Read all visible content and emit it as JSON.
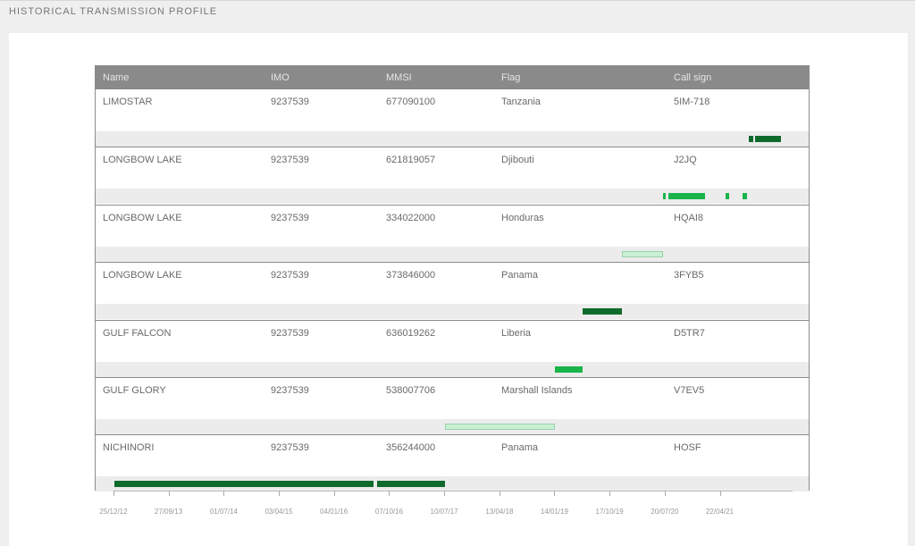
{
  "page_title": "HISTORICAL TRANSMISSION PROFILE",
  "columns": [
    "Name",
    "IMO",
    "MMSI",
    "Flag",
    "Call sign"
  ],
  "rows": [
    {
      "name": "LIMOSTAR",
      "imo": "9237539",
      "mmsi": "677090100",
      "flag": "Tanzania",
      "call_sign": "5IM-718",
      "periods": [
        {
          "start": "2021-09-10",
          "end": "2021-10-01",
          "color": "#0e6b2c"
        },
        {
          "start": "2021-10-10",
          "end": "2022-02-20",
          "color": "#0e6b2c"
        }
      ]
    },
    {
      "name": "LONGBOW LAKE",
      "imo": "9237539",
      "mmsi": "621819057",
      "flag": "Djibouti",
      "call_sign": "J2JQ",
      "periods": [
        {
          "start": "2020-07-05",
          "end": "2020-07-20",
          "color": "#19b44a"
        },
        {
          "start": "2020-08-05",
          "end": "2021-02-01",
          "color": "#19b44a"
        },
        {
          "start": "2021-05-15",
          "end": "2021-06-05",
          "color": "#19b44a"
        },
        {
          "start": "2021-08-10",
          "end": "2021-08-30",
          "color": "#19b44a"
        }
      ]
    },
    {
      "name": "LONGBOW LAKE",
      "imo": "9237539",
      "mmsi": "334022000",
      "flag": "Honduras",
      "call_sign": "HQAI8",
      "periods": [
        {
          "start": "2019-12-15",
          "end": "2020-07-05",
          "color": "#c8f0d4"
        }
      ]
    },
    {
      "name": "LONGBOW LAKE",
      "imo": "9237539",
      "mmsi": "373846000",
      "flag": "Panama",
      "call_sign": "3FYB5",
      "periods": [
        {
          "start": "2019-06-01",
          "end": "2019-12-15",
          "color": "#0e6b2c"
        }
      ]
    },
    {
      "name": "GULF FALCON",
      "imo": "9237539",
      "mmsi": "636019262",
      "flag": "Liberia",
      "call_sign": "D5TR7",
      "periods": [
        {
          "start": "2019-01-10",
          "end": "2019-06-01",
          "color": "#19b44a"
        }
      ]
    },
    {
      "name": "GULF GLORY",
      "imo": "9237539",
      "mmsi": "538007706",
      "flag": "Marshall Islands",
      "call_sign": "V7EV5",
      "periods": [
        {
          "start": "2017-07-10",
          "end": "2019-01-10",
          "color": "#c8f0d4"
        }
      ]
    },
    {
      "name": "NICHINORI",
      "imo": "9237539",
      "mmsi": "356244000",
      "flag": "Panama",
      "call_sign": "HOSF",
      "periods": [
        {
          "start": "2012-12-25",
          "end": "2016-07-15",
          "color": "#0e6b2c"
        },
        {
          "start": "2016-08-01",
          "end": "2017-07-10",
          "color": "#0e6b2c"
        }
      ]
    }
  ],
  "axis": {
    "start": "2012-12-25",
    "end": "2022-04-22",
    "ticks": [
      {
        "date": "2012-12-25",
        "label": "25/12/12"
      },
      {
        "date": "2013-09-27",
        "label": "27/09/13"
      },
      {
        "date": "2014-07-01",
        "label": "01/07/14"
      },
      {
        "date": "2015-04-03",
        "label": "03/04/15"
      },
      {
        "date": "2016-01-04",
        "label": "04/01/16"
      },
      {
        "date": "2016-10-07",
        "label": "07/10/16"
      },
      {
        "date": "2017-07-10",
        "label": "10/07/17"
      },
      {
        "date": "2018-04-13",
        "label": "13/04/18"
      },
      {
        "date": "2019-01-14",
        "label": "14/01/19"
      },
      {
        "date": "2019-10-17",
        "label": "17/10/19"
      },
      {
        "date": "2020-07-20",
        "label": "20/07/20"
      },
      {
        "date": "2021-04-22",
        "label": "22/04/21"
      }
    ]
  }
}
